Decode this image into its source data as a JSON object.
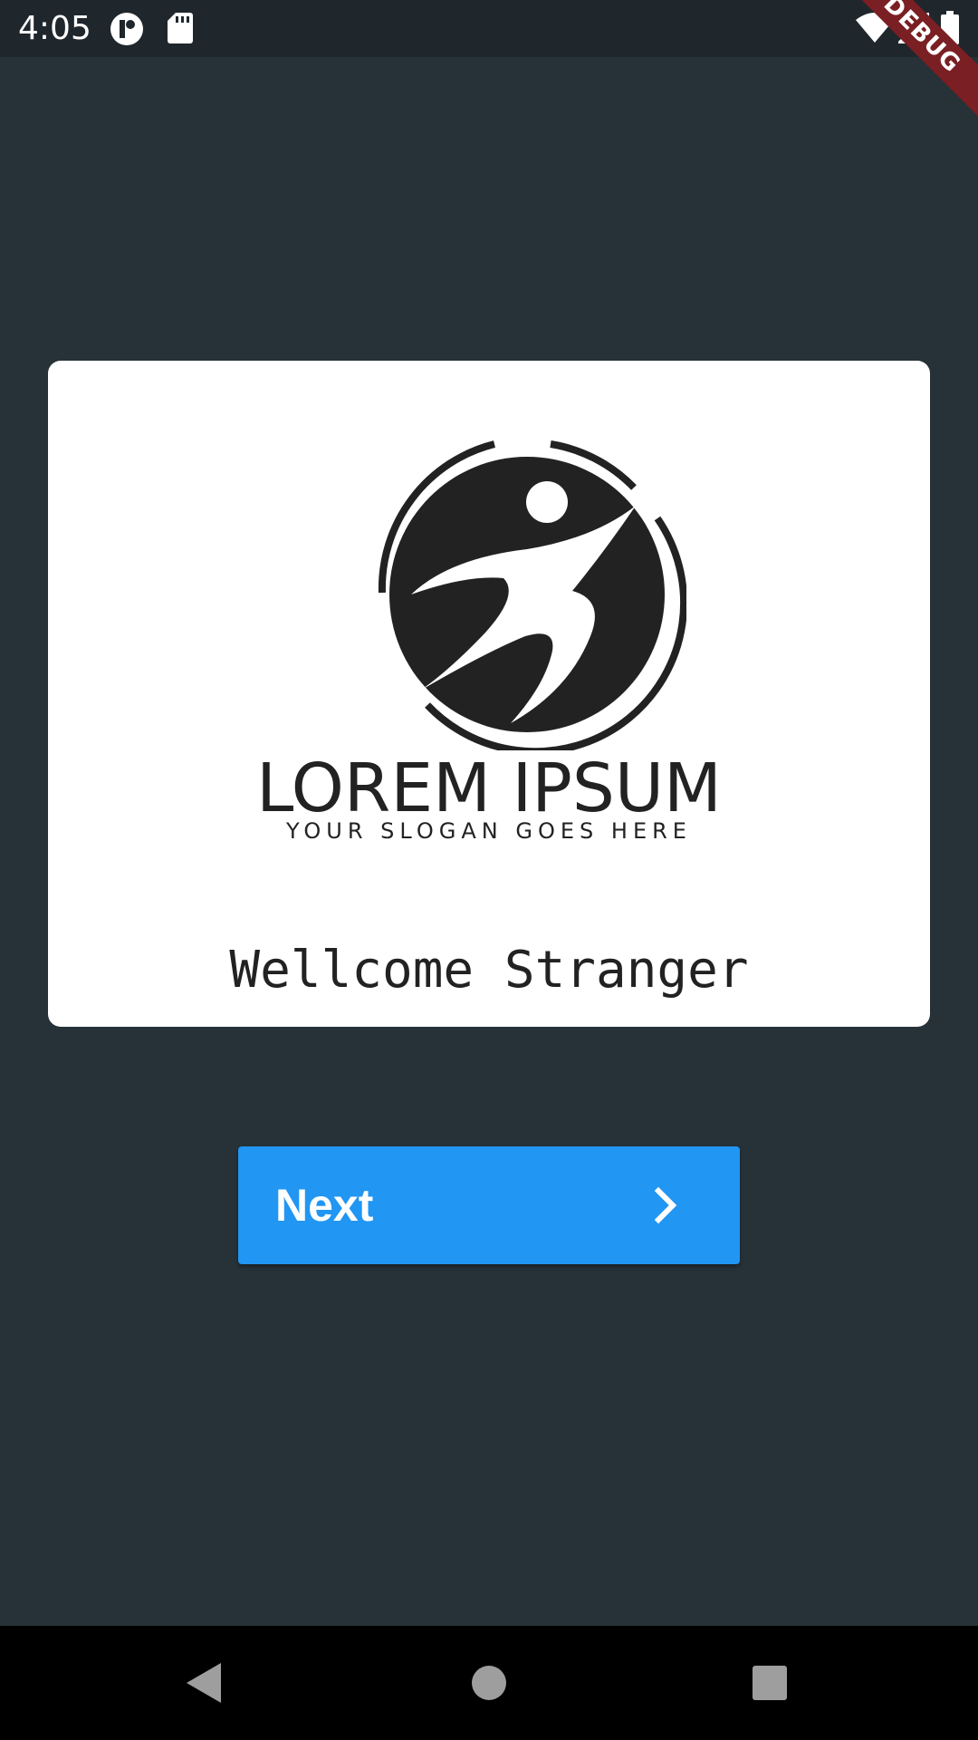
{
  "status_bar": {
    "time": "4:05",
    "icons": [
      "app-notification-icon",
      "sd-card-icon",
      "wifi-icon",
      "signal-icon",
      "battery-icon"
    ],
    "debug_label": "DEBUG"
  },
  "card": {
    "logo_title": "LOREM IPSUM",
    "logo_slogan": "YOUR SLOGAN GOES HERE",
    "welcome": "Wellcome Stranger"
  },
  "next_button": {
    "label": "Next",
    "icon": "chevron-right-icon"
  },
  "nav_bar": {
    "buttons": [
      "back-icon",
      "home-icon",
      "recents-icon"
    ]
  },
  "colors": {
    "background": "#263238",
    "status_bar": "#1f272d",
    "card": "#ffffff",
    "button": "#2196f3",
    "debug_banner": "#7a1f23",
    "nav_bar": "#000000"
  }
}
